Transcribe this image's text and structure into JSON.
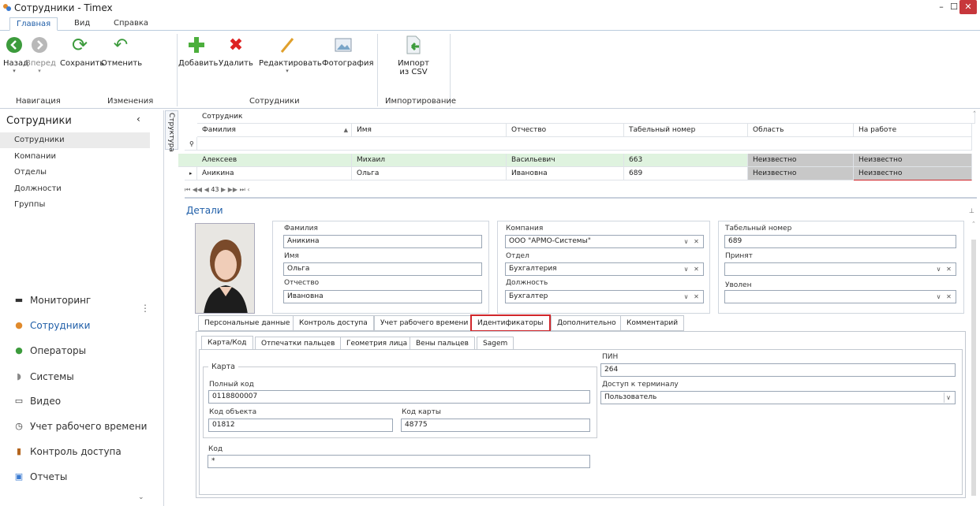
{
  "window": {
    "title": "Сотрудники - Timex"
  },
  "ribbon": {
    "tabs": [
      "Главная",
      "Вид",
      "Справка"
    ],
    "buttons": {
      "back": "Назад",
      "forward": "Вперед",
      "save": "Сохранить",
      "cancel": "Отменить",
      "add": "Добавить",
      "delete": "Удалить",
      "edit": "Редактировать",
      "photo": "Фотография",
      "import_line1": "Импорт",
      "import_line2": "из CSV"
    },
    "groups": {
      "navigation": "Навигация",
      "changes": "Изменения",
      "employees": "Сотрудники",
      "import": "Импортирование"
    }
  },
  "leftnav": {
    "header": "Сотрудники",
    "structure_tab": "Структура",
    "items": [
      "Сотрудники",
      "Компании",
      "Отделы",
      "Должности",
      "Группы"
    ],
    "modules": [
      "Мониторинг",
      "Сотрудники",
      "Операторы",
      "Системы",
      "Видео",
      "Учет рабочего времени",
      "Контроль доступа",
      "Отчеты"
    ]
  },
  "grid": {
    "band": "Сотрудник",
    "columns": [
      "Фамилия",
      "Имя",
      "Отчество",
      "Табельный номер",
      "Область",
      "На работе"
    ],
    "rows": [
      [
        "Алексеев",
        "Михаил",
        "Васильевич",
        "663",
        "Неизвестно",
        "Неизвестно"
      ],
      [
        "Аникина",
        "Ольга",
        "Ивановна",
        "689",
        "Неизвестно",
        "Неизвестно"
      ]
    ],
    "pager": "43"
  },
  "details": {
    "title": "Детали",
    "labels": {
      "lastname": "Фамилия",
      "firstname": "Имя",
      "middlename": "Отчество",
      "company": "Компания",
      "department": "Отдел",
      "position": "Должность",
      "tabnum": "Табельный номер",
      "hired": "Принят",
      "fired": "Уволен"
    },
    "values": {
      "lastname": "Аникина",
      "firstname": "Ольга",
      "middlename": "Ивановна",
      "company": "ООО \"АРМО-Системы\"",
      "department": "Бухгалтерия",
      "position": "Бухгалтер",
      "tabnum": "689",
      "hired": "",
      "fired": ""
    },
    "tabs": [
      "Персональные данные",
      "Контроль доступа",
      "Учет рабочего времени",
      "Идентификаторы",
      "Дополнительно",
      "Комментарий"
    ],
    "subtabs": [
      "Карта/Код",
      "Отпечатки пальцев",
      "Геометрия лица",
      "Вены пальцев",
      "Sagem"
    ],
    "card": {
      "group": "Карта",
      "full_code_label": "Полный код",
      "full_code": "0118800007",
      "object_code_label": "Код объекта",
      "object_code": "01812",
      "card_code_label": "Код карты",
      "card_code": "48775",
      "code_label": "Код",
      "code": "*",
      "pin_label": "ПИН",
      "pin": "264",
      "terminal_label": "Доступ к терминалу",
      "terminal": "Пользователь"
    }
  },
  "colors": {
    "accent": "#1f5ea8",
    "row_green": "#dff3df",
    "gray_cell": "#c8c8c8",
    "highlight_red": "#d0262b"
  }
}
